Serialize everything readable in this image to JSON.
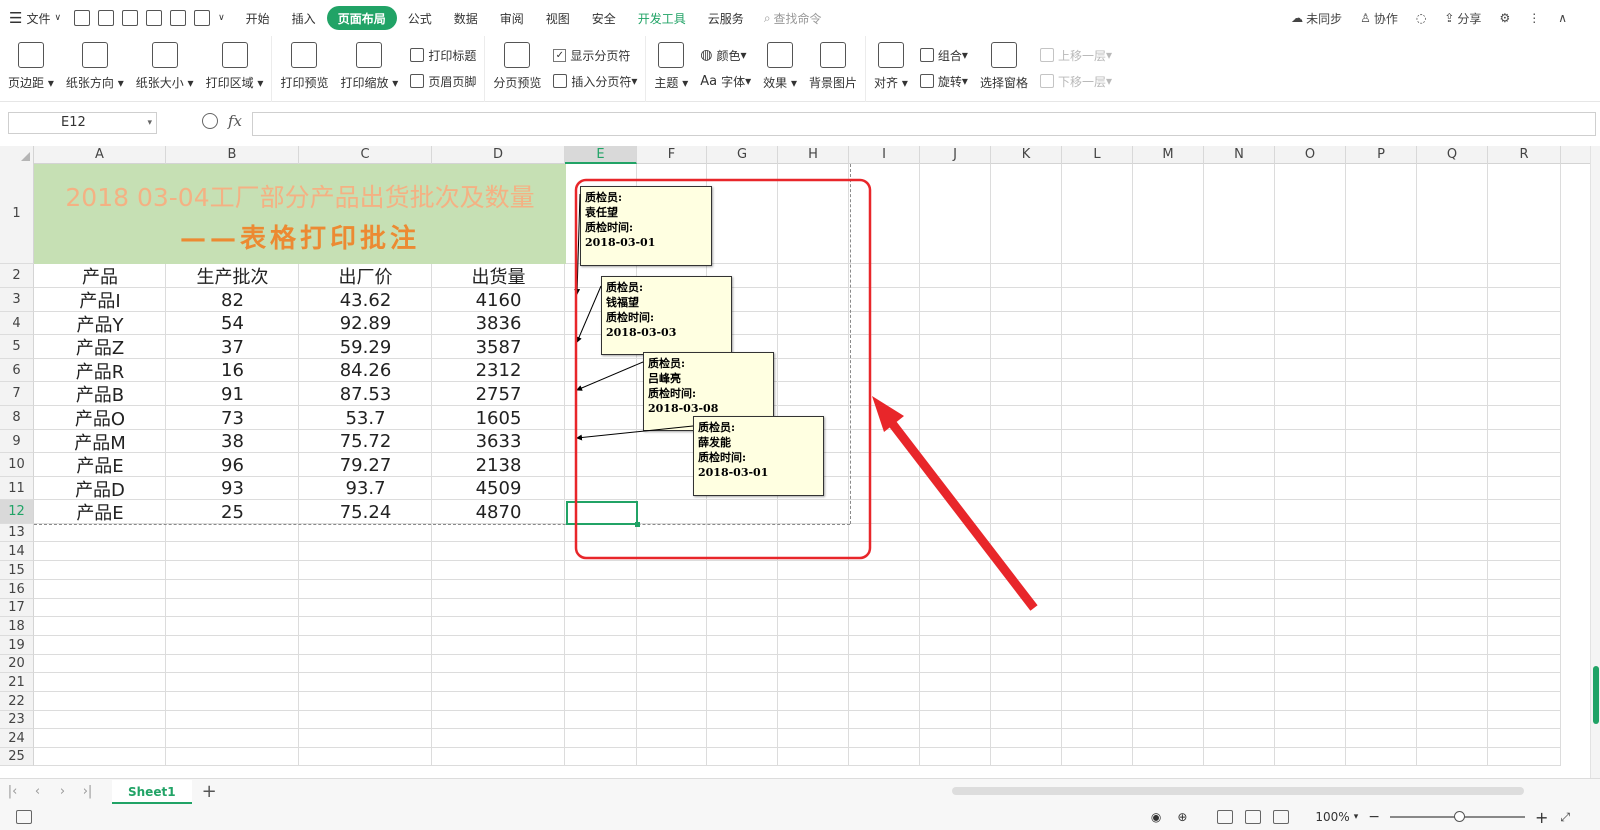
{
  "menu": {
    "file": "文件",
    "tabs": [
      "开始",
      "插入",
      "页面布局",
      "公式",
      "数据",
      "审阅",
      "视图",
      "安全",
      "开发工具",
      "云服务"
    ],
    "search": "查找命令",
    "sync": "未同步",
    "collab": "协作",
    "share": "分享"
  },
  "ribbon": {
    "margins": "页边距",
    "orientation": "纸张方向",
    "size": "纸张大小",
    "print_area": "打印区域",
    "print_preview": "打印预览",
    "print_scale": "打印缩放",
    "print_titles": "打印标题",
    "header_footer": "页眉页脚",
    "page_break_preview": "分页预览",
    "show_page_breaks": "显示分页符",
    "insert_page_break": "插入分页符",
    "theme": "主题",
    "colors": "颜色",
    "fonts": "字体",
    "effects": "效果",
    "background": "背景图片",
    "align": "对齐",
    "group": "组合",
    "rotate": "旋转",
    "selection_pane": "选择窗格",
    "bring_forward": "上移一层",
    "send_backward": "下移一层"
  },
  "formula_bar": {
    "name_box": "E12",
    "fx": "fx",
    "value": ""
  },
  "columns": [
    "A",
    "B",
    "C",
    "D",
    "E",
    "F",
    "G",
    "H",
    "I",
    "J",
    "K",
    "L",
    "M",
    "N",
    "O",
    "P",
    "Q",
    "R"
  ],
  "rows": [
    "1",
    "2",
    "3",
    "4",
    "5",
    "6",
    "7",
    "8",
    "9",
    "10",
    "11",
    "12",
    "13",
    "14",
    "15",
    "16",
    "17",
    "18",
    "19",
    "20",
    "21",
    "22",
    "23",
    "24",
    "25"
  ],
  "sheet": {
    "title_line1": "2018 03-04工厂部分产品出货批次及数量",
    "title_line2": "——表格打印批注",
    "headers": [
      "产品",
      "生产批次",
      "出厂价",
      "出货量"
    ],
    "data": [
      [
        "产品I",
        "82",
        "43.62",
        "4160"
      ],
      [
        "产品Y",
        "54",
        "92.89",
        "3836"
      ],
      [
        "产品Z",
        "37",
        "59.29",
        "3587"
      ],
      [
        "产品R",
        "16",
        "84.26",
        "2312"
      ],
      [
        "产品B",
        "91",
        "87.53",
        "2757"
      ],
      [
        "产品O",
        "73",
        "53.7",
        "1605"
      ],
      [
        "产品M",
        "38",
        "75.72",
        "3633"
      ],
      [
        "产品E",
        "96",
        "79.27",
        "2138"
      ],
      [
        "产品D",
        "93",
        "93.7",
        "4509"
      ],
      [
        "产品E",
        "25",
        "75.24",
        "4870"
      ]
    ]
  },
  "comments": [
    {
      "label": "质检员:",
      "name": "袁任望",
      "time_label": "质检时间:",
      "time": "2018-03-01"
    },
    {
      "label": "质检员:",
      "name": "钱福望",
      "time_label": "质检时间:",
      "time": "2018-03-03"
    },
    {
      "label": "质检员:",
      "name": "吕峰亮",
      "time_label": "质检时间:",
      "time": "2018-03-08"
    },
    {
      "label": "质检员:",
      "name": "薛发能",
      "time_label": "质检时间:",
      "time": "2018-03-01"
    }
  ],
  "sheet_tabs": {
    "active": "Sheet1",
    "add": "+"
  },
  "status": {
    "zoom": "100%",
    "zoom_minus": "−",
    "zoom_plus": "+"
  },
  "colors": {
    "accent": "#21a366",
    "title_fill": "#c6e0b4",
    "annotation": "#e8262a"
  }
}
